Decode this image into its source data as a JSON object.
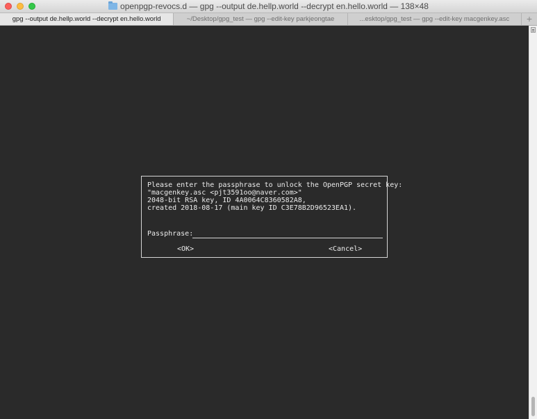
{
  "window": {
    "title": "openpgp-revocs.d — gpg --output de.hellp.world --decrypt en.hello.world — 138×48"
  },
  "tabs": [
    {
      "label": "gpg --output de.hellp.world --decrypt en.hello.world",
      "active": true
    },
    {
      "label": "~/Desktop/gpg_test — gpg --edit-key parkjeongtae",
      "active": false
    },
    {
      "label": "...esktop/gpg_test — gpg --edit-key macgenkey.asc",
      "active": false
    }
  ],
  "tab_add": "+",
  "dialog": {
    "lines": [
      "Please enter the passphrase to unlock the OpenPGP secret key:",
      "\"macgenkey.asc <pjt3591oo@naver.com>\"",
      "2048-bit RSA key, ID 4A0064C8360582A8,",
      "created 2018-08-17 (main key ID C3E78B2D96523EA1)."
    ],
    "passphrase_label": "Passphrase:",
    "passphrase_value": "",
    "ok_label": "<OK>",
    "cancel_label": "<Cancel>"
  },
  "colors": {
    "terminal_bg": "#2a2a2a",
    "terminal_fg": "#ececec",
    "close": "#fc605c",
    "minimize": "#fdbc40",
    "maximize": "#34c84a"
  }
}
